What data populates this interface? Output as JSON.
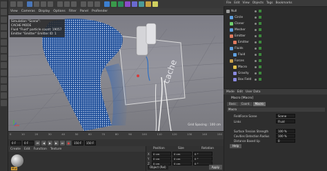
{
  "menubar": {
    "items": [
      "View",
      "Cameras",
      "Display",
      "Options",
      "Filter",
      "Panel",
      "ProRender"
    ]
  },
  "hud": {
    "lines": [
      "Simulation \"Scene\":",
      "CACHE MODE",
      "Fluid \"Fluid\" particle count: 19057",
      "Emitter \"Emitter\" Emitter ID: 1"
    ]
  },
  "viewport": {
    "grid_spacing": "Grid Spacing : 100 cm",
    "label_text": "cache"
  },
  "timeline": {
    "ticks": [
      "0",
      "10",
      "20",
      "30",
      "40",
      "50",
      "60",
      "70",
      "80",
      "90",
      "100",
      "110",
      "120",
      "130",
      "140",
      "150"
    ]
  },
  "transport": {
    "start": "0 F",
    "current": "0 F",
    "end": "150 F",
    "end2": "150 F"
  },
  "material_manager": {
    "menu": [
      "Create",
      "Edit",
      "Function",
      "Texture"
    ],
    "material_name": "Mat"
  },
  "coords": {
    "headers": [
      "Position",
      "Size",
      "Rotation"
    ],
    "rows": [
      {
        "axis": "X",
        "pos": "0 cm",
        "size": "0 cm",
        "rot": "0 °"
      },
      {
        "axis": "Y",
        "pos": "0 cm",
        "size": "0 cm",
        "rot": "0 °"
      },
      {
        "axis": "Z",
        "pos": "0 cm",
        "size": "0 cm",
        "rot": "0 °"
      }
    ],
    "mode": "Object (Rel)",
    "size_mode": "Size",
    "apply_label": "Apply"
  },
  "object_manager": {
    "menu": [
      "File",
      "Edit",
      "View",
      "Objects",
      "Tags",
      "Bookmarks"
    ],
    "objects": [
      {
        "name": "Null",
        "color": "#9a9a9a",
        "indent": 0
      },
      {
        "name": "Circle",
        "color": "#5fa0e0",
        "indent": 1
      },
      {
        "name": "Cloner",
        "color": "#6fcf6f",
        "indent": 1
      },
      {
        "name": "Mesher",
        "color": "#5fa0e0",
        "indent": 1
      },
      {
        "name": "Emitter",
        "color": "#e07a5f",
        "indent": 1
      },
      {
        "name": "Emitter",
        "color": "#e07a5f",
        "indent": 2
      },
      {
        "name": "Fluids",
        "color": "#5fa0e0",
        "indent": 1
      },
      {
        "name": "Fluid",
        "color": "#5fa0e0",
        "indent": 2
      },
      {
        "name": "Forces",
        "color": "#c9a04a",
        "indent": 1
      },
      {
        "name": "Macro",
        "color": "#e0c04a",
        "indent": 2
      },
      {
        "name": "Gravity",
        "color": "#8a8ae0",
        "indent": 2
      },
      {
        "name": "Box Field",
        "color": "#8a8ae0",
        "indent": 2
      }
    ]
  },
  "attributes": {
    "menu": [
      "Mode",
      "Edit",
      "User Data"
    ],
    "title": "Macro [Macro]",
    "tabs": [
      "Basic",
      "Coord.",
      "Macro"
    ],
    "active_tab": "Macro",
    "section": "Macro",
    "rows": [
      {
        "label": "FieldForce Scene",
        "value": "Scene"
      },
      {
        "label": "Links",
        "value": "Fluid"
      },
      {
        "label": "Surface Tension Strength",
        "value": "100 %"
      },
      {
        "label": "Cavities Detection Radius",
        "value": "100 %"
      },
      {
        "label": "Distance Based Up",
        "value": "0"
      }
    ],
    "help_label": "Help"
  },
  "colors": {
    "accent": "#e2a83a",
    "active_fluid": "#5a9fe6",
    "particle_blue": "#2f6fc2"
  }
}
